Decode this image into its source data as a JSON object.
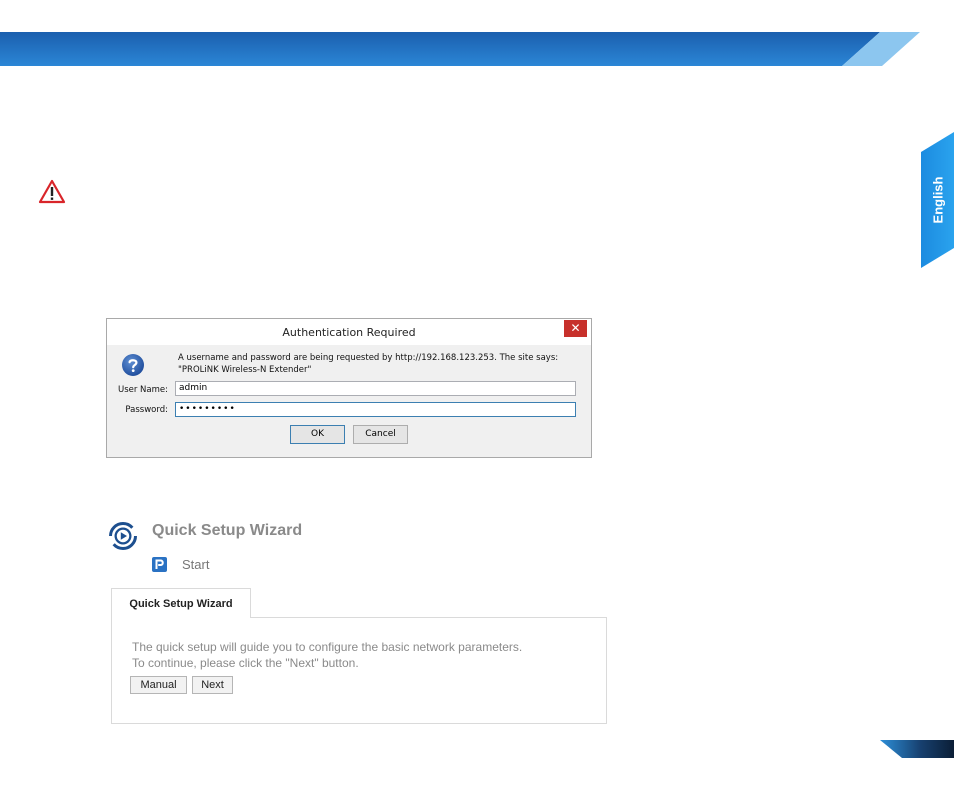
{
  "side_tab": {
    "label": "English"
  },
  "auth_dialog": {
    "title": "Authentication Required",
    "close_glyph": "✕",
    "message": "A username and password are being requested by http://192.168.123.253. The site says: \"PROLiNK Wireless-N Extender\"",
    "username_label": "User Name:",
    "username_value": "admin",
    "password_label": "Password:",
    "password_value": "•••••••••",
    "ok_label": "OK",
    "cancel_label": "Cancel"
  },
  "wizard": {
    "heading": "Quick Setup Wizard",
    "start_label": "Start",
    "tab_label": "Quick Setup Wizard",
    "description_line1": "The quick setup will guide you to configure the basic network parameters.",
    "description_line2": "To continue, please click the \"Next\" button.",
    "manual_label": "Manual",
    "next_label": "Next"
  },
  "colors": {
    "brand_blue": "#1a6fc4",
    "light_blue": "#5aaee8",
    "warning_red": "#d9252a",
    "close_red": "#c7302b"
  }
}
